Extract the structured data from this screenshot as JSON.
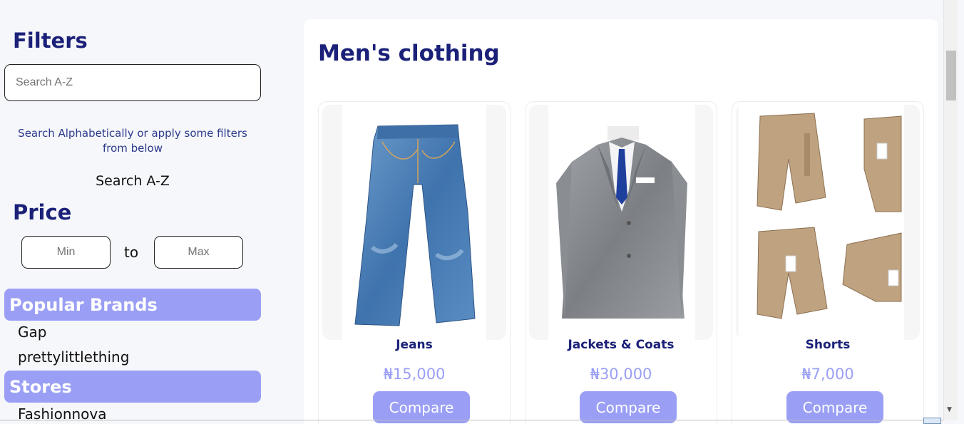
{
  "sidebar": {
    "filters_title": "Filters",
    "search_placeholder": "Search A-Z",
    "hint": "Search Alphabetically or apply some filters from below",
    "search_label": "Search A-Z",
    "price_title": "Price",
    "min_placeholder": "Min",
    "to_label": "to",
    "max_placeholder": "Max",
    "brands_title": "Popular Brands",
    "brands": [
      "Gap",
      "prettylittlething"
    ],
    "stores_title": "Stores",
    "stores": [
      "Fashionnova"
    ]
  },
  "main": {
    "title": "Men's clothing",
    "products": [
      {
        "name": "Jeans",
        "price": "₦15,000",
        "button": "Compare",
        "image": "jeans-image"
      },
      {
        "name": "Jackets & Coats",
        "price": "₦30,000",
        "button": "Compare",
        "image": "jacket-image"
      },
      {
        "name": "Shorts",
        "price": "₦7,000",
        "button": "Compare",
        "image": "shorts-image"
      }
    ]
  },
  "colors": {
    "heading": "#1b2178",
    "accent": "#9a9ff5",
    "background": "#f6f7fa"
  }
}
